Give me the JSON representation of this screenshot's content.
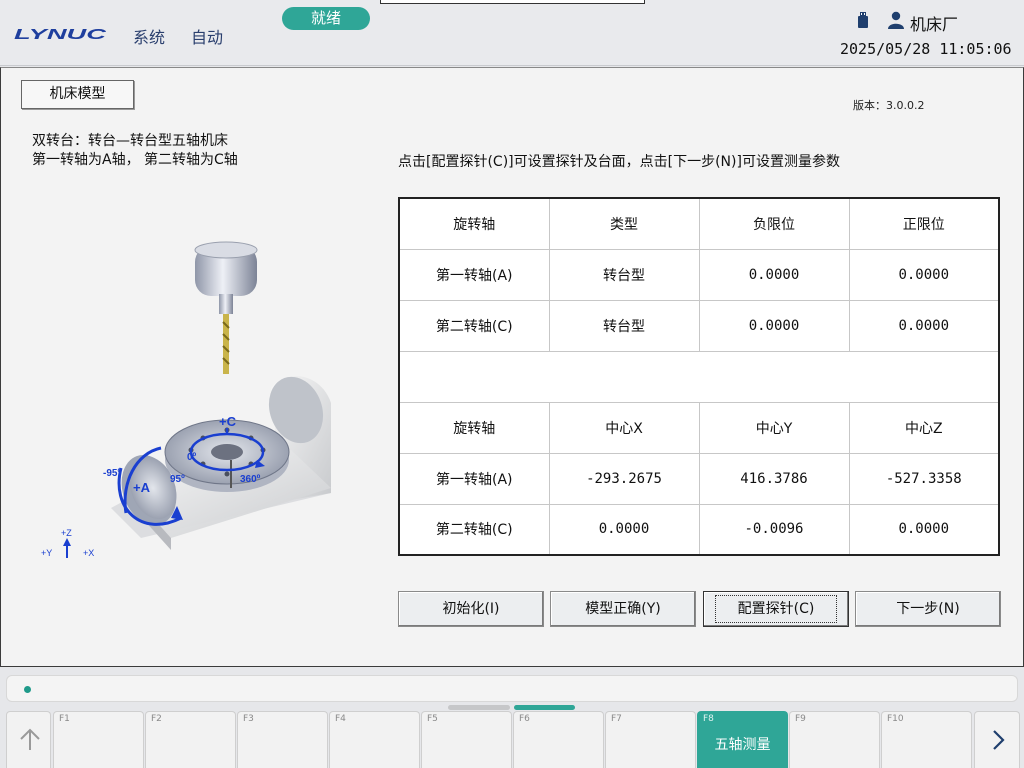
{
  "header": {
    "logo_text": "LYNUC",
    "menu": {
      "system": "系统",
      "auto": "自动"
    },
    "status": "就绪",
    "user": "机床厂",
    "datetime": "2025/05/28 11:05:06"
  },
  "main": {
    "model_title": "机床模型",
    "version": "版本：3.0.0.2",
    "description_line1": "双转台：转台—转台型五轴机床",
    "description_line2": "第一转轴为A轴，  第二转轴为C轴",
    "hint": "点击[配置探针(C)]可设置探针及台面，点击[下一步(N)]可设置测量参数",
    "diagram_labels": {
      "c_axis": "+C",
      "a_axis": "+A",
      "c_zero": "0º",
      "c_360": "360º",
      "a_neg": "-95º",
      "a_pos": "95º",
      "coord_z": "+Z",
      "coord_y": "+Y",
      "coord_x": "+X"
    },
    "table_limits": {
      "headers": [
        "旋转轴",
        "类型",
        "负限位",
        "正限位"
      ],
      "rows": [
        [
          "第一转轴(A)",
          "转台型",
          "0.0000",
          "0.0000"
        ],
        [
          "第二转轴(C)",
          "转台型",
          "0.0000",
          "0.0000"
        ]
      ]
    },
    "table_centers": {
      "headers": [
        "旋转轴",
        "中心X",
        "中心Y",
        "中心Z"
      ],
      "rows": [
        [
          "第一转轴(A)",
          "-293.2675",
          "416.3786",
          "-527.3358"
        ],
        [
          "第二转轴(C)",
          "0.0000",
          "-0.0096",
          "0.0000"
        ]
      ]
    },
    "buttons": {
      "init": "初始化(I)",
      "model_ok": "模型正确(Y)",
      "config_probe": "配置探针(C)",
      "next": "下一步(N)"
    }
  },
  "fkeys": [
    {
      "num": "F1",
      "label": ""
    },
    {
      "num": "F2",
      "label": ""
    },
    {
      "num": "F3",
      "label": ""
    },
    {
      "num": "F4",
      "label": ""
    },
    {
      "num": "F5",
      "label": ""
    },
    {
      "num": "F6",
      "label": ""
    },
    {
      "num": "F7",
      "label": ""
    },
    {
      "num": "F8",
      "label": "五轴测量"
    },
    {
      "num": "F9",
      "label": ""
    },
    {
      "num": "F10",
      "label": ""
    }
  ],
  "icons": {
    "usb": "usb-icon",
    "user": "user-icon",
    "up": "arrow-up-icon",
    "right": "chevron-right-icon"
  },
  "colors": {
    "accent": "#2fa697",
    "brand_blue": "#1f3f9e",
    "diagram_blue": "#1a3fd0"
  }
}
